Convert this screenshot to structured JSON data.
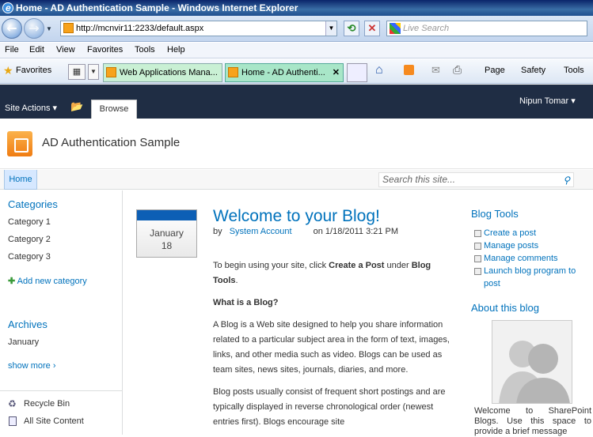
{
  "window": {
    "title": "Home - AD Authentication Sample - Windows Internet Explorer"
  },
  "address_bar": {
    "url": "http://mcnvir11:2233/default.aspx",
    "search_placeholder": "Live Search"
  },
  "menu": [
    "File",
    "Edit",
    "View",
    "Favorites",
    "Tools",
    "Help"
  ],
  "favorites_bar": {
    "favorites_label": "Favorites",
    "tabs": [
      {
        "label": "Web Applications Mana..."
      },
      {
        "label": "Home - AD Authenti..."
      }
    ],
    "commands": [
      "Page",
      "Safety",
      "Tools"
    ]
  },
  "ribbon": {
    "site_actions": "Site Actions",
    "browse_tab": "Browse",
    "user": "Nipun Tomar"
  },
  "site": {
    "title": "AD Authentication Sample"
  },
  "top_nav": {
    "home": "Home",
    "search_placeholder": "Search this site..."
  },
  "left_nav": {
    "categories_heading": "Categories",
    "categories": [
      "Category 1",
      "Category 2",
      "Category 3"
    ],
    "add_category": "Add new category",
    "archives_heading": "Archives",
    "archives": [
      "January"
    ],
    "show_more": "show more",
    "recycle_bin": "Recycle Bin",
    "all_site_content": "All Site Content"
  },
  "post": {
    "month": "January",
    "day": "18",
    "title": "Welcome to your Blog!",
    "by": "by",
    "author": "System Account",
    "date": "on 1/18/2011 3:21 PM",
    "p1_a": "To begin using your site, click ",
    "p1_b": "Create a Post",
    "p1_c": " under ",
    "p1_d": "Blog Tools",
    "p1_e": ".",
    "h_what": "What is a Blog?",
    "p2": "A Blog is a Web site designed to help you share information related to a particular subject area in the form of text, images, links, and other media such as video. Blogs can be used as team sites, news sites, journals, diaries, and more.",
    "p3": "Blog posts usually consist of frequent short postings and are typically displayed in reverse chronological order (newest entries first). Blogs encourage site"
  },
  "right_col": {
    "tools_heading": "Blog Tools",
    "tools": [
      "Create a post",
      "Manage posts",
      "Manage comments",
      "Launch blog program to post"
    ],
    "about_heading": "About this blog",
    "about_text": "Welcome to SharePoint Blogs. Use this space to provide a brief message"
  }
}
